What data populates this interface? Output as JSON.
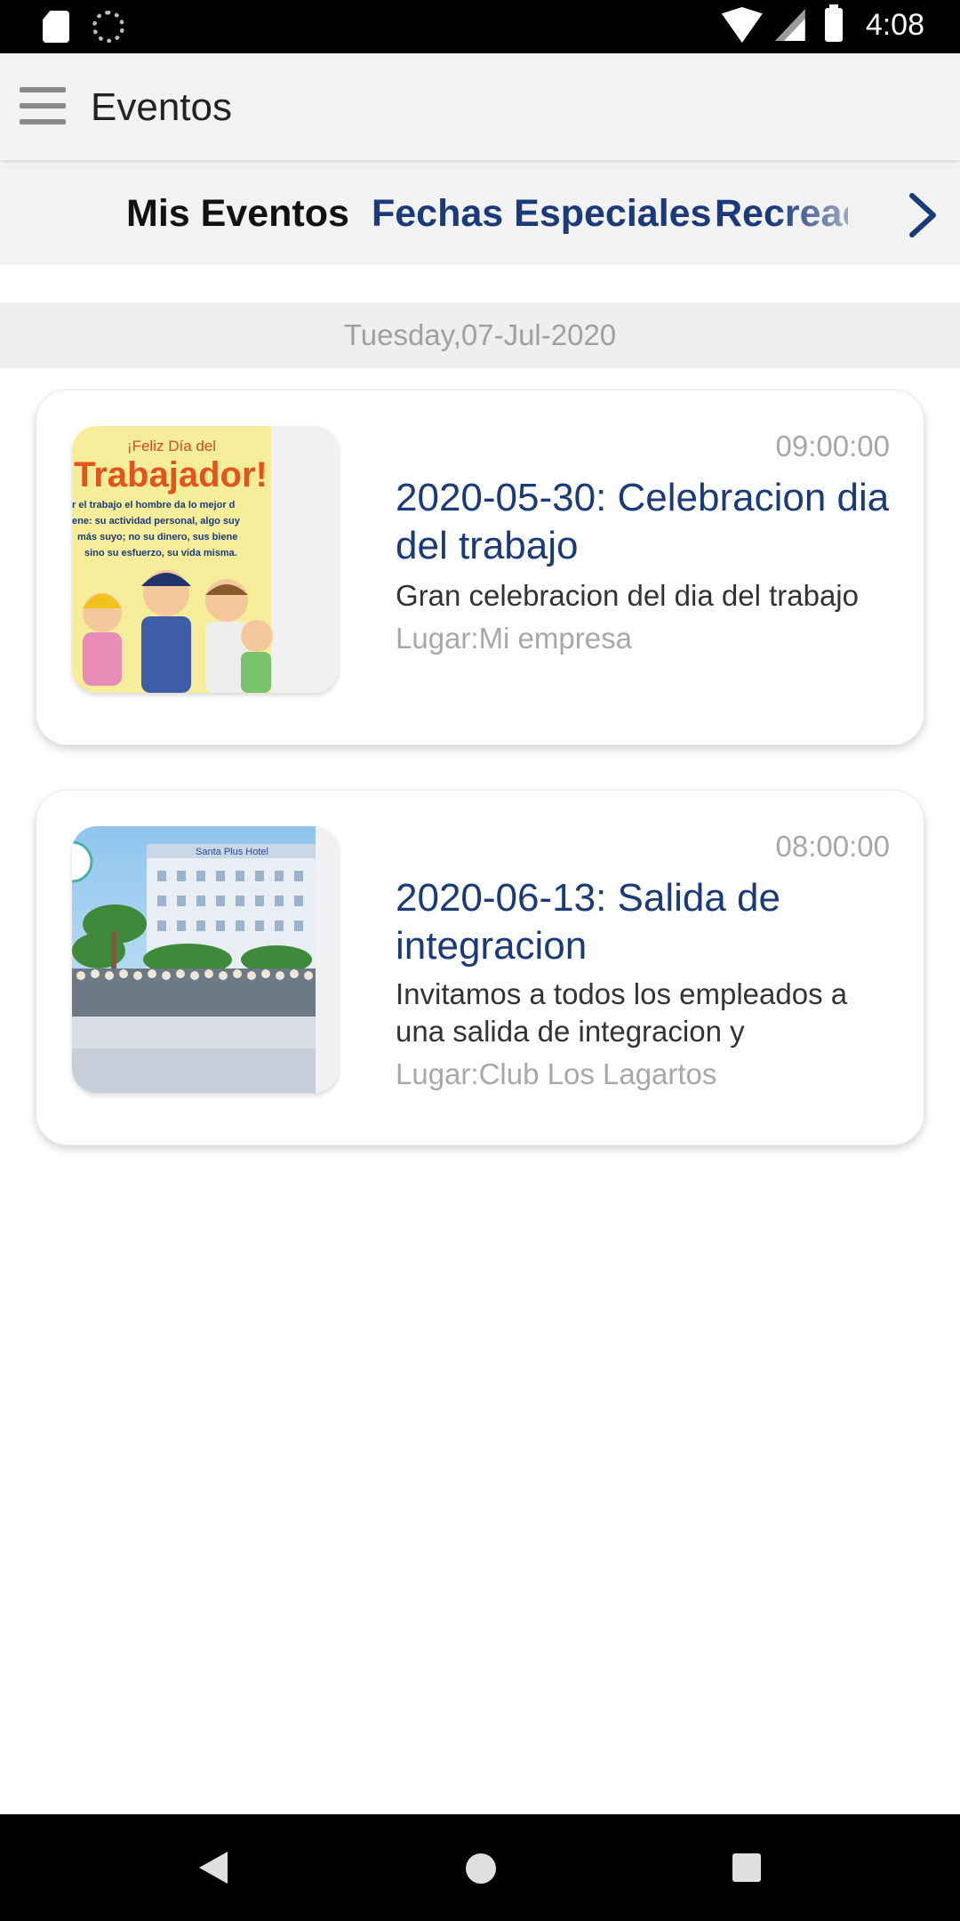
{
  "status_bar": {
    "time": "4:08",
    "icons": [
      "sd-card-icon",
      "sync-icon",
      "wifi-icon",
      "signal-icon",
      "battery-icon"
    ]
  },
  "app_bar": {
    "title": "Eventos",
    "menu_icon": "hamburger-menu-icon"
  },
  "tabs": {
    "items": [
      {
        "label": "Mis Eventos",
        "active": true
      },
      {
        "label": "Fechas Especiales",
        "active": false
      },
      {
        "label": "Recreac",
        "active": false
      }
    ],
    "next_icon": "chevron-right-icon",
    "active_color": "#111111",
    "inactive_color": "#1b3a7a"
  },
  "date_header": "Tuesday,07-Jul-2020",
  "events": [
    {
      "time": "09:00:00",
      "title": "2020-05-30: Celebracion dia del trabajo",
      "description": "Gran celebracion del dia del trabajo",
      "place": "Lugar:Mi empresa",
      "image": {
        "banner_top": "¡Feliz Día del",
        "banner_main": "Trabajador!",
        "lines": [
          "r el trabajo el hombre da lo mejor d",
          "ene: su actividad personal, algo suy",
          "más suyo; no su dinero, sus biene",
          "sino su esfuerzo, su vida misma."
        ]
      }
    },
    {
      "time": "08:00:00",
      "title": "2020-06-13: Salida de integracion",
      "description": "Invitamos a todos los empleados a una salida de integracion y",
      "place": "Lugar:Club Los Lagartos",
      "image": {
        "sign": "Santa Plus Hotel"
      }
    }
  ],
  "nav_bar": {
    "icons": [
      "back-icon",
      "home-icon",
      "recent-apps-icon"
    ]
  },
  "colors": {
    "accent": "#1b3a7a",
    "muted_text": "#a7a7a7",
    "header_bg": "#f2f2f2"
  }
}
